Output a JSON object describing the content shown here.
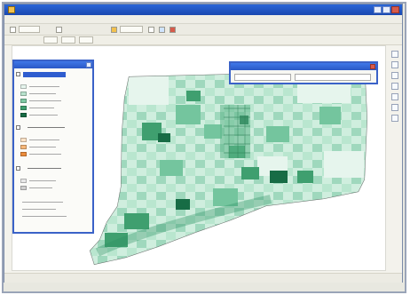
{
  "app": {
    "window_title": "",
    "menu_items": [
      "",
      "",
      "",
      "",
      "",
      "",
      "",
      ""
    ]
  },
  "colors": {
    "title_bar": "#1a48b0",
    "map_light": "#d7efe3",
    "map_mid": "#74c59e",
    "map_dark": "#1f8b5a",
    "highlight": "#f2a05a",
    "panel_border": "#3a62c8"
  },
  "icons": {
    "window": [
      "app-icon",
      "minimize-icon",
      "maximize-icon",
      "close-icon"
    ],
    "toolbar": [
      "zoom-in-icon",
      "zoom-out-icon",
      "pan-icon",
      "identify-icon",
      "select-icon",
      "measure-icon"
    ],
    "vertical_tools": [
      "pointer-icon",
      "zoom-icon",
      "pan-icon",
      "info-icon",
      "find-icon",
      "layers-icon",
      "legend-icon"
    ]
  },
  "legend": {
    "title": "",
    "groups": [
      {
        "name": "",
        "items": [
          {
            "color": "#e6f5ed"
          },
          {
            "color": "#b8e2cc"
          },
          {
            "color": "#7fc8a3"
          },
          {
            "color": "#3f9f6f"
          },
          {
            "color": "#176c45"
          }
        ]
      },
      {
        "name": "",
        "items": [
          {
            "color": "#fde2c6"
          },
          {
            "color": "#f6b77a"
          },
          {
            "color": "#ec8d3c"
          }
        ]
      },
      {
        "name": "",
        "items": [
          {
            "color": "#e8e8e8"
          },
          {
            "color": "#cfcfcf"
          }
        ]
      }
    ]
  },
  "status": {
    "left": "",
    "right": ""
  }
}
